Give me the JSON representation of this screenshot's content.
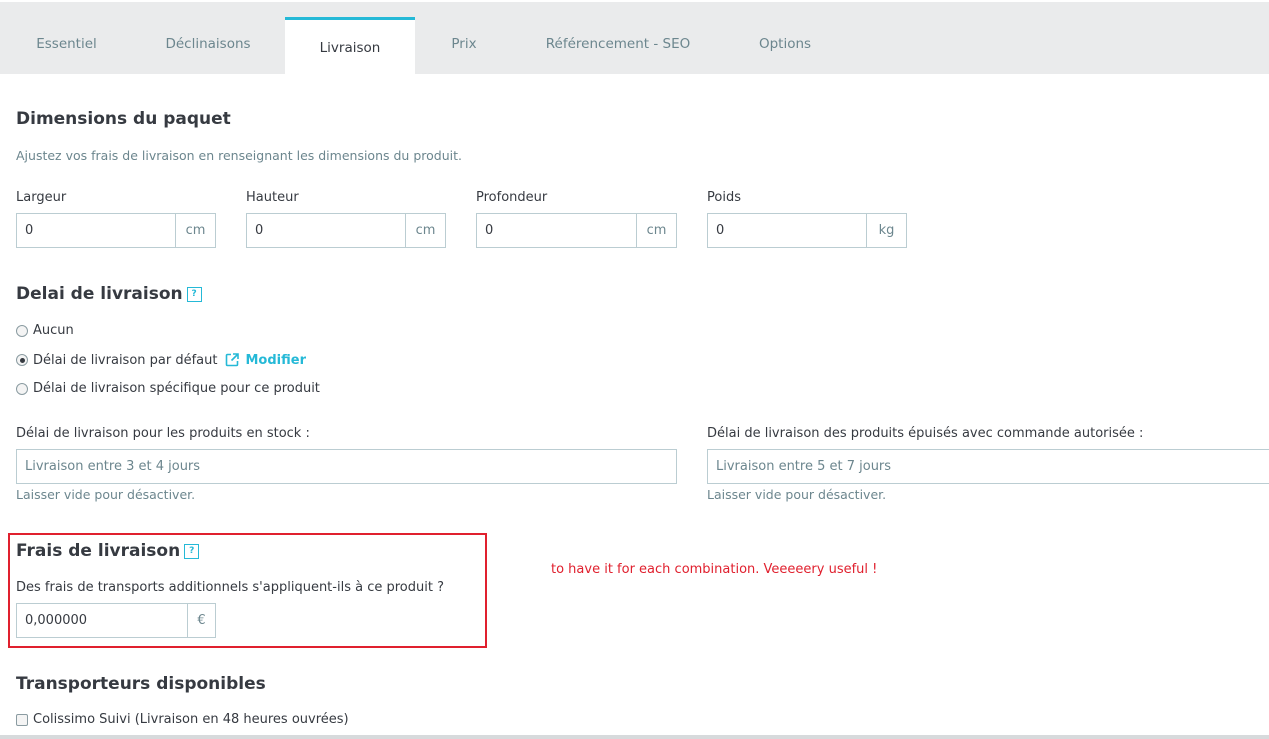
{
  "tabs": [
    {
      "label": "Essentiel"
    },
    {
      "label": "Déclinaisons"
    },
    {
      "label": "Livraison"
    },
    {
      "label": "Prix"
    },
    {
      "label": "Référencement - SEO"
    },
    {
      "label": "Options"
    }
  ],
  "dimensions": {
    "title": "Dimensions du paquet",
    "description": "Ajustez vos frais de livraison en renseignant les dimensions du produit.",
    "fields": [
      {
        "label": "Largeur",
        "value": "0",
        "unit": "cm"
      },
      {
        "label": "Hauteur",
        "value": "0",
        "unit": "cm"
      },
      {
        "label": "Profondeur",
        "value": "0",
        "unit": "cm"
      },
      {
        "label": "Poids",
        "value": "0",
        "unit": "kg"
      }
    ]
  },
  "delivery_time": {
    "title": "Delai de livraison",
    "help_glyph": "?",
    "options": [
      {
        "label": "Aucun",
        "selected": false
      },
      {
        "label": "Délai de livraison par défaut",
        "selected": true
      },
      {
        "label": "Délai de livraison spécifique pour ce produit",
        "selected": false
      }
    ],
    "modify_label": "Modifier",
    "in_stock_label": "Délai de livraison pour les produits en stock :",
    "in_stock_placeholder": "Livraison entre 3 et 4 jours",
    "in_stock_help": "Laisser vide pour désactiver.",
    "out_of_stock_label": "Délai de livraison des produits épuisés avec commande autorisée :",
    "out_of_stock_placeholder": "Livraison entre 5 et 7 jours",
    "out_of_stock_help": "Laisser vide pour désactiver."
  },
  "shipping_fees": {
    "title": "Frais de livraison",
    "help_glyph": "?",
    "question": "Des frais de transports additionnels s'appliquent-ils à ce produit ?",
    "value": "0,000000",
    "currency": "€"
  },
  "annotation": "to have it for each combination. Veeeeery useful !",
  "carriers": {
    "title": "Transporteurs disponibles",
    "items": [
      {
        "label": "Colissimo Suivi (Livraison en 48 heures ouvrées)",
        "checked": false
      }
    ]
  },
  "colors": {
    "accent": "#25b9d7",
    "annotation": "#e0202e",
    "text": "#363a41",
    "muted": "#6c868e",
    "border": "#bbcdd2",
    "tabbar": "#eaebec"
  }
}
